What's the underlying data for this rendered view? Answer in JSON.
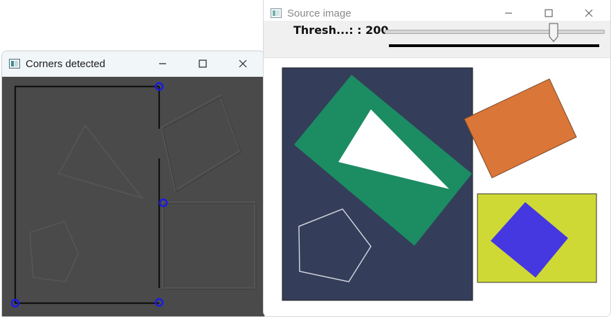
{
  "corners_window": {
    "title": "Corners detected",
    "icon": "app-window-icon",
    "controls": [
      "minimize-icon",
      "maximize-icon",
      "close-icon"
    ]
  },
  "source_window": {
    "title": "Source image",
    "icon": "app-window-icon",
    "controls": [
      "minimize-icon",
      "maximize-icon",
      "close-icon"
    ],
    "trackbar": {
      "label": "Thresh...: : 200",
      "value": 200,
      "max": 255
    }
  },
  "colors": {
    "navy_rect": "#343d59",
    "green_rect": "#1c8c63",
    "white_triangle": "#ffffff",
    "orange_rect": "#d97638",
    "yellow_rect": "#cfd936",
    "blue_diamond": "#4538e0",
    "corner_marker": "#1a1ae6",
    "dark_gray_canvas": "#4a4a4a"
  }
}
